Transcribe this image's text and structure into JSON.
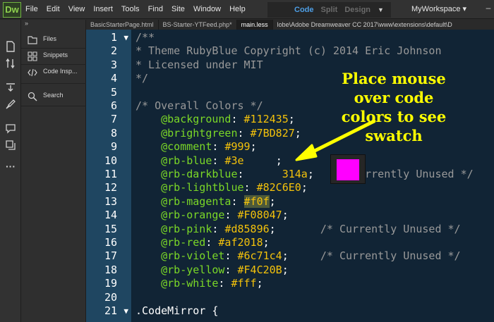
{
  "app": {
    "logo_text": "Dw",
    "menus": [
      "File",
      "Edit",
      "View",
      "Insert",
      "Tools",
      "Find",
      "Site",
      "Window",
      "Help"
    ],
    "view_modes": {
      "active": "Code",
      "split": "Split",
      "design": "Design"
    },
    "workspace": "MyWorkspace ▾",
    "minimize": "–"
  },
  "side_panel": {
    "collapse_glyph": "»",
    "items": [
      {
        "label": "Files",
        "icon": "files-icon"
      },
      {
        "label": "Snippets",
        "icon": "snippets-icon"
      },
      {
        "label": "Code Insp...",
        "icon": "code-inspector-icon"
      },
      {
        "label": "Search",
        "icon": "search-icon"
      }
    ]
  },
  "tabs": [
    {
      "label": "BasicStarterPage.html",
      "active": false
    },
    {
      "label": "BS-Starter-YTFeed.php*",
      "active": false
    },
    {
      "label": "main.less",
      "active": true
    },
    {
      "label": "lobe\\Adobe Dreamweaver CC 2017\\www\\extensions\\default\\D",
      "active": false
    }
  ],
  "code_lines": [
    {
      "n": "1",
      "fold": "▼",
      "parts": [
        {
          "t": "/**",
          "c": "comment"
        }
      ]
    },
    {
      "n": "2",
      "fold": "",
      "parts": [
        {
          "t": "* Theme RubyBlue Copyright (c) 2014 Eric Johnson",
          "c": "comment"
        }
      ]
    },
    {
      "n": "3",
      "fold": "",
      "parts": [
        {
          "t": "* Licensed under MIT",
          "c": "comment"
        }
      ]
    },
    {
      "n": "4",
      "fold": "",
      "parts": [
        {
          "t": "*/",
          "c": "comment"
        }
      ]
    },
    {
      "n": "5",
      "fold": "",
      "parts": []
    },
    {
      "n": "6",
      "fold": "",
      "parts": [
        {
          "t": "/* Overall Colors */",
          "c": "comment"
        }
      ]
    },
    {
      "n": "7",
      "fold": "",
      "parts": [
        {
          "t": "    @background",
          "c": "var"
        },
        {
          "t": ": ",
          "c": "plain"
        },
        {
          "t": "#112435",
          "c": "val"
        },
        {
          "t": ";",
          "c": "plain"
        }
      ]
    },
    {
      "n": "8",
      "fold": "",
      "parts": [
        {
          "t": "    @brightgreen",
          "c": "var"
        },
        {
          "t": ": ",
          "c": "plain"
        },
        {
          "t": "#7BD827",
          "c": "val"
        },
        {
          "t": ";",
          "c": "plain"
        }
      ]
    },
    {
      "n": "9",
      "fold": "",
      "parts": [
        {
          "t": "    @comment",
          "c": "var"
        },
        {
          "t": ": ",
          "c": "plain"
        },
        {
          "t": "#999",
          "c": "val"
        },
        {
          "t": ";",
          "c": "plain"
        }
      ]
    },
    {
      "n": "10",
      "fold": "",
      "parts": [
        {
          "t": "    @rb-blue",
          "c": "var"
        },
        {
          "t": ": ",
          "c": "plain"
        },
        {
          "t": "#3e",
          "c": "val"
        },
        {
          "t": "     ",
          "c": "plain"
        },
        {
          "t": ";",
          "c": "plain"
        }
      ]
    },
    {
      "n": "11",
      "fold": "",
      "parts": [
        {
          "t": "    @rb-darkblue",
          "c": "var"
        },
        {
          "t": ":",
          "c": "plain"
        },
        {
          "t": "      314a",
          "c": "val"
        },
        {
          "t": ";   ",
          "c": "plain"
        },
        {
          "t": "/* Currently Unused */",
          "c": "comment"
        }
      ]
    },
    {
      "n": "12",
      "fold": "",
      "parts": [
        {
          "t": "    @rb-lightblue",
          "c": "var"
        },
        {
          "t": ": ",
          "c": "plain"
        },
        {
          "t": "#82C6E0",
          "c": "val"
        },
        {
          "t": ";",
          "c": "plain"
        }
      ]
    },
    {
      "n": "13",
      "fold": "",
      "parts": [
        {
          "t": "    @rb-magenta",
          "c": "var"
        },
        {
          "t": ": ",
          "c": "plain"
        },
        {
          "t": "#f0f",
          "c": "val",
          "hl": true
        },
        {
          "t": ";",
          "c": "plain"
        }
      ]
    },
    {
      "n": "14",
      "fold": "",
      "parts": [
        {
          "t": "    @rb-orange",
          "c": "var"
        },
        {
          "t": ": ",
          "c": "plain"
        },
        {
          "t": "#F08047",
          "c": "val"
        },
        {
          "t": ";",
          "c": "plain"
        }
      ]
    },
    {
      "n": "15",
      "fold": "",
      "parts": [
        {
          "t": "    @rb-pink",
          "c": "var"
        },
        {
          "t": ": ",
          "c": "plain"
        },
        {
          "t": "#d85896",
          "c": "val"
        },
        {
          "t": ";       ",
          "c": "plain"
        },
        {
          "t": "/* Currently Unused */",
          "c": "comment"
        }
      ]
    },
    {
      "n": "16",
      "fold": "",
      "parts": [
        {
          "t": "    @rb-red",
          "c": "var"
        },
        {
          "t": ": ",
          "c": "plain"
        },
        {
          "t": "#af2018",
          "c": "val"
        },
        {
          "t": ";",
          "c": "plain"
        }
      ]
    },
    {
      "n": "17",
      "fold": "",
      "parts": [
        {
          "t": "    @rb-violet",
          "c": "var"
        },
        {
          "t": ": ",
          "c": "plain"
        },
        {
          "t": "#6c71c4",
          "c": "val"
        },
        {
          "t": ";     ",
          "c": "plain"
        },
        {
          "t": "/* Currently Unused */",
          "c": "comment"
        }
      ]
    },
    {
      "n": "18",
      "fold": "",
      "parts": [
        {
          "t": "    @rb-yellow",
          "c": "var"
        },
        {
          "t": ": ",
          "c": "plain"
        },
        {
          "t": "#F4C20B",
          "c": "val"
        },
        {
          "t": ";",
          "c": "plain"
        }
      ]
    },
    {
      "n": "19",
      "fold": "",
      "parts": [
        {
          "t": "    @rb-white",
          "c": "var"
        },
        {
          "t": ": ",
          "c": "plain"
        },
        {
          "t": "#fff",
          "c": "val"
        },
        {
          "t": ";",
          "c": "plain"
        }
      ]
    },
    {
      "n": "20",
      "fold": "",
      "parts": []
    },
    {
      "n": "21",
      "fold": "▼",
      "parts": [
        {
          "t": ".CodeMirror {",
          "c": "plain"
        }
      ]
    }
  ],
  "swatch": {
    "color": "#ff00ff"
  },
  "callout": {
    "text": "Place mouse\nover code\ncolors to see\nswatch",
    "color": "#ffff00"
  },
  "colors": {
    "editor_bg": "#112435",
    "gutter_bg": "#1f4661",
    "variable": "#7bd827",
    "value": "#f4c20b",
    "comment": "#999999"
  }
}
